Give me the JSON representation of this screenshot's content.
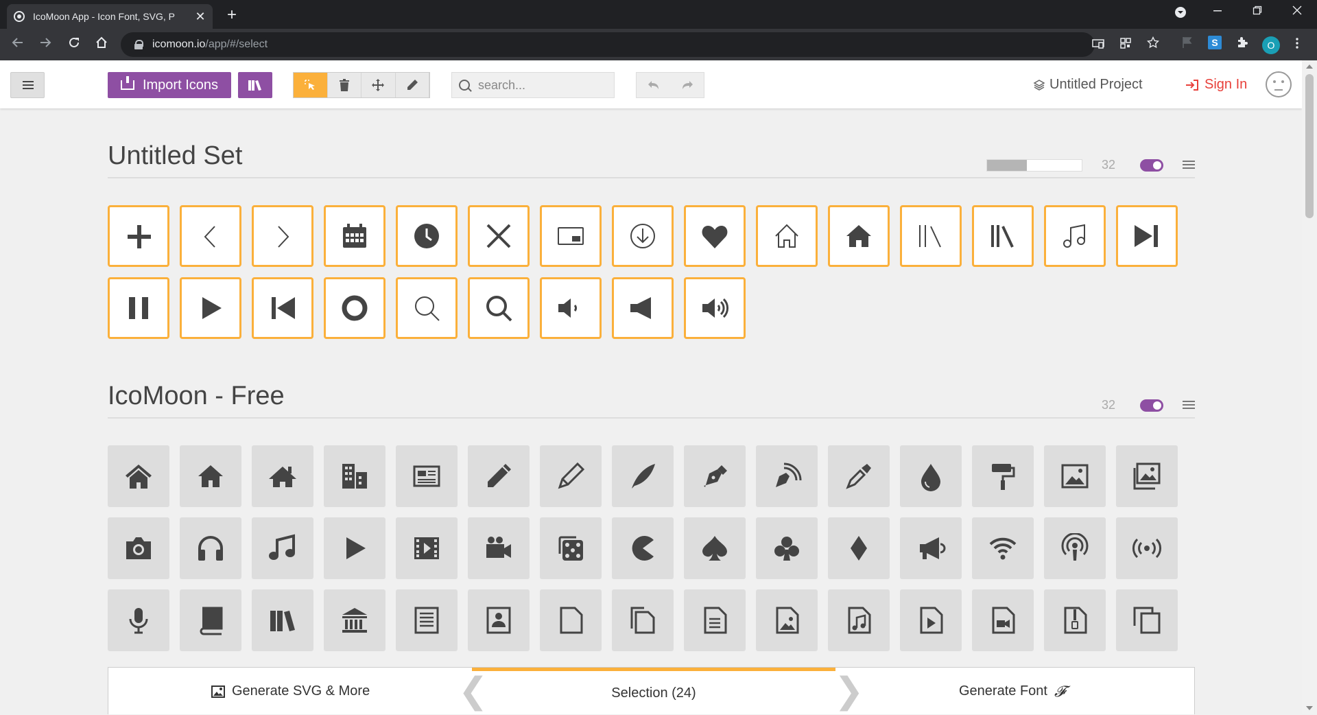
{
  "browser": {
    "tab_title": "IcoMoon App - Icon Font, SVG, P",
    "tab_close": "✕",
    "new_tab": "+",
    "url_host": "icomoon.io",
    "url_path": "/app/#/select",
    "profile_initial": "O"
  },
  "toolbar": {
    "import_label": "Import Icons",
    "search_placeholder": "search...",
    "project_label": "Untitled Project",
    "signin_label": "Sign In"
  },
  "sets": [
    {
      "title": "Untitled Set",
      "count": "32",
      "slider_fraction": 0.42,
      "icons": [
        "plus-icon",
        "arrow-left-icon",
        "arrow-right-icon",
        "calendar-icon",
        "clock-icon",
        "close-icon",
        "pip-icon",
        "download-circle-icon",
        "heart-icon",
        "home-outline-icon",
        "home-solid-icon",
        "library-thin-icon",
        "library-bold-icon",
        "music-note-outline-icon",
        "skip-next-icon",
        "pause-icon",
        "play-icon",
        "skip-previous-icon",
        "record-icon",
        "search-thin-icon",
        "search-icon",
        "volume-low-icon",
        "volume-mute-icon",
        "volume-high-icon"
      ]
    },
    {
      "title": "IcoMoon - Free",
      "count": "32",
      "icons": [
        "home-icon",
        "home2-icon",
        "home3-icon",
        "office-icon",
        "newspaper-icon",
        "pencil-icon",
        "pencil2-icon",
        "quill-icon",
        "pen-icon",
        "blog-icon",
        "eyedropper-icon",
        "droplet-icon",
        "paint-format-icon",
        "image-icon",
        "images-icon",
        "camera-icon",
        "headphones-icon",
        "music-icon",
        "play-icon",
        "film-icon",
        "video-camera-icon",
        "dice-icon",
        "pacman-icon",
        "spades-icon",
        "clubs-icon",
        "diamonds-icon",
        "bullhorn-icon",
        "connection-icon",
        "podcast-icon",
        "feed-icon",
        "mic-icon",
        "book-icon",
        "books-icon",
        "library-icon",
        "file-text-icon",
        "profile-icon",
        "file-empty-icon",
        "files-empty-icon",
        "file-text2-icon",
        "file-picture-icon",
        "file-music-icon",
        "file-play-icon",
        "file-video-icon",
        "file-zip-icon",
        "copy-icon"
      ]
    }
  ],
  "footer": {
    "svg_label": "Generate SVG & More",
    "selection_label": "Selection (24)",
    "font_label": "Generate Font",
    "font_glyph": "𝓕"
  },
  "colors": {
    "accent_purple": "#8e4fa3",
    "accent_orange": "#fbb03b",
    "signin_red": "#e8403a"
  }
}
